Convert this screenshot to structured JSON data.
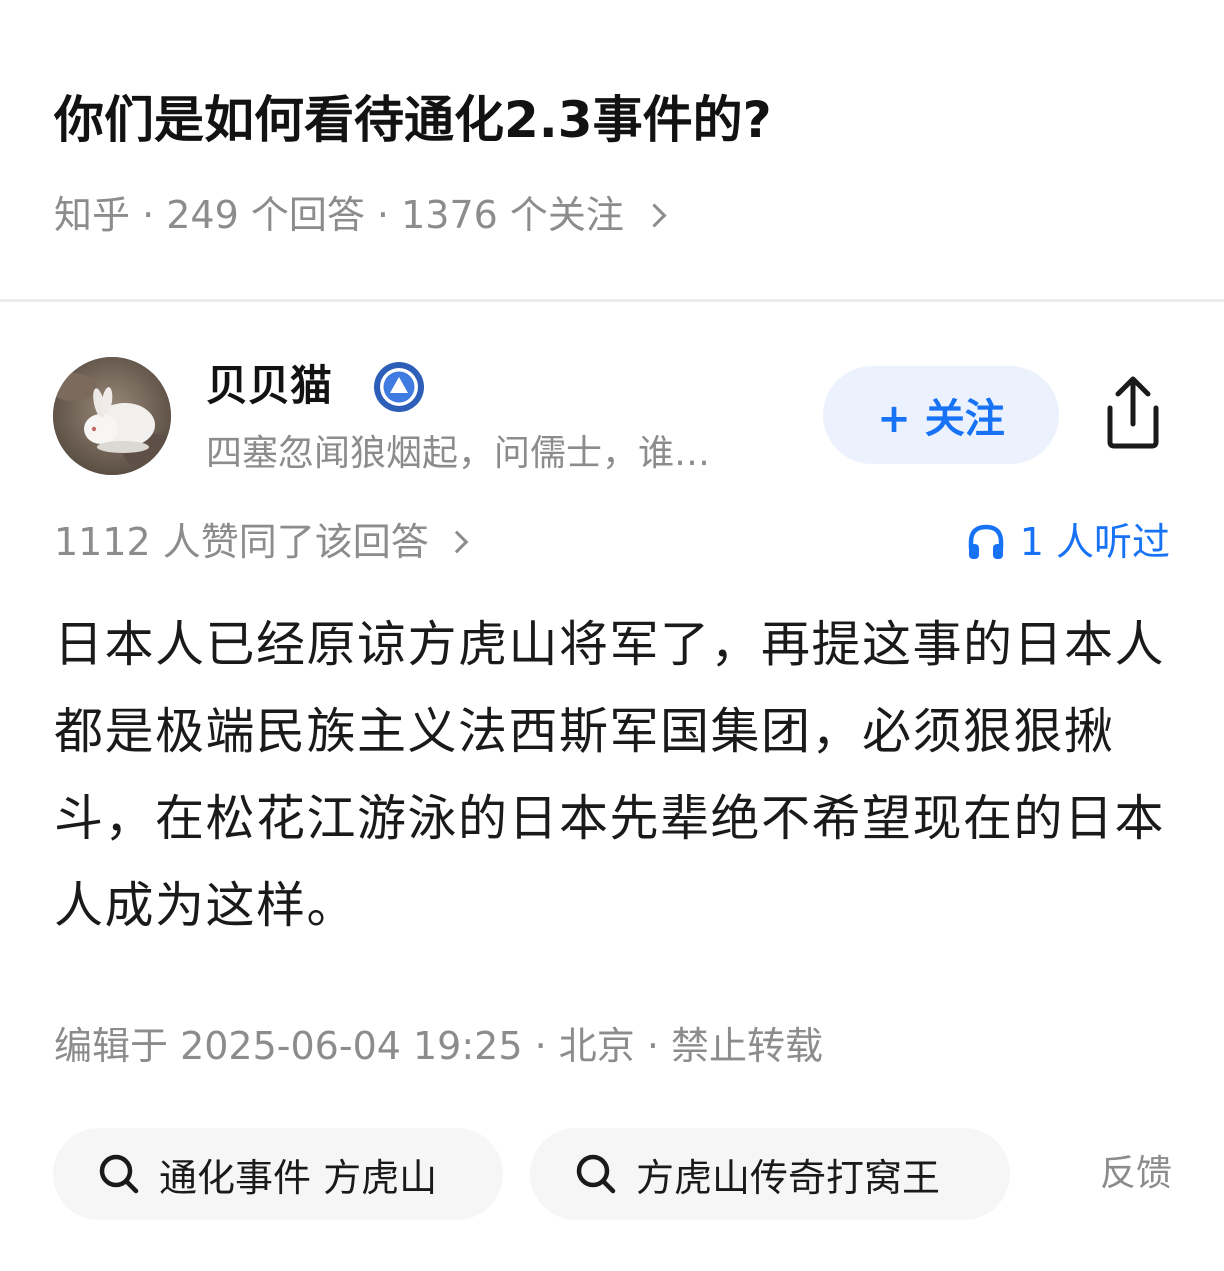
{
  "question": {
    "title": "你们是如何看待通化2.3事件的?",
    "meta": "知乎 · 249 个回答 · 1376 个关注"
  },
  "author": {
    "name": "贝贝猫",
    "bio": "四塞忽闻狼烟起，问儒士，谁…",
    "follow_label": "+ 关注"
  },
  "stats": {
    "upvotes": "1112 人赞同了该回答",
    "listened": "1 人听过"
  },
  "answer": {
    "text": "日本人已经原谅方虎山将军了，再提这事的日本人都是极端民族主义法西斯军国集团，必须狠狠揪斗，在松花江游泳的日本先辈绝不希望现在的日本人成为这样。",
    "edited": "编辑于 2025-06-04 19:25 · 北京 · 禁止转载"
  },
  "related_searches": [
    {
      "label": "通化事件 方虎山",
      "icon": "search-icon"
    },
    {
      "label": "方虎山传奇打窝王",
      "icon": "search-icon"
    }
  ],
  "feedback_label": "反馈",
  "colors": {
    "accent": "#1772f6",
    "follow_bg": "#ebf2fd",
    "muted_text": "#8c8c8c",
    "chip_bg": "#f6f6f6"
  }
}
